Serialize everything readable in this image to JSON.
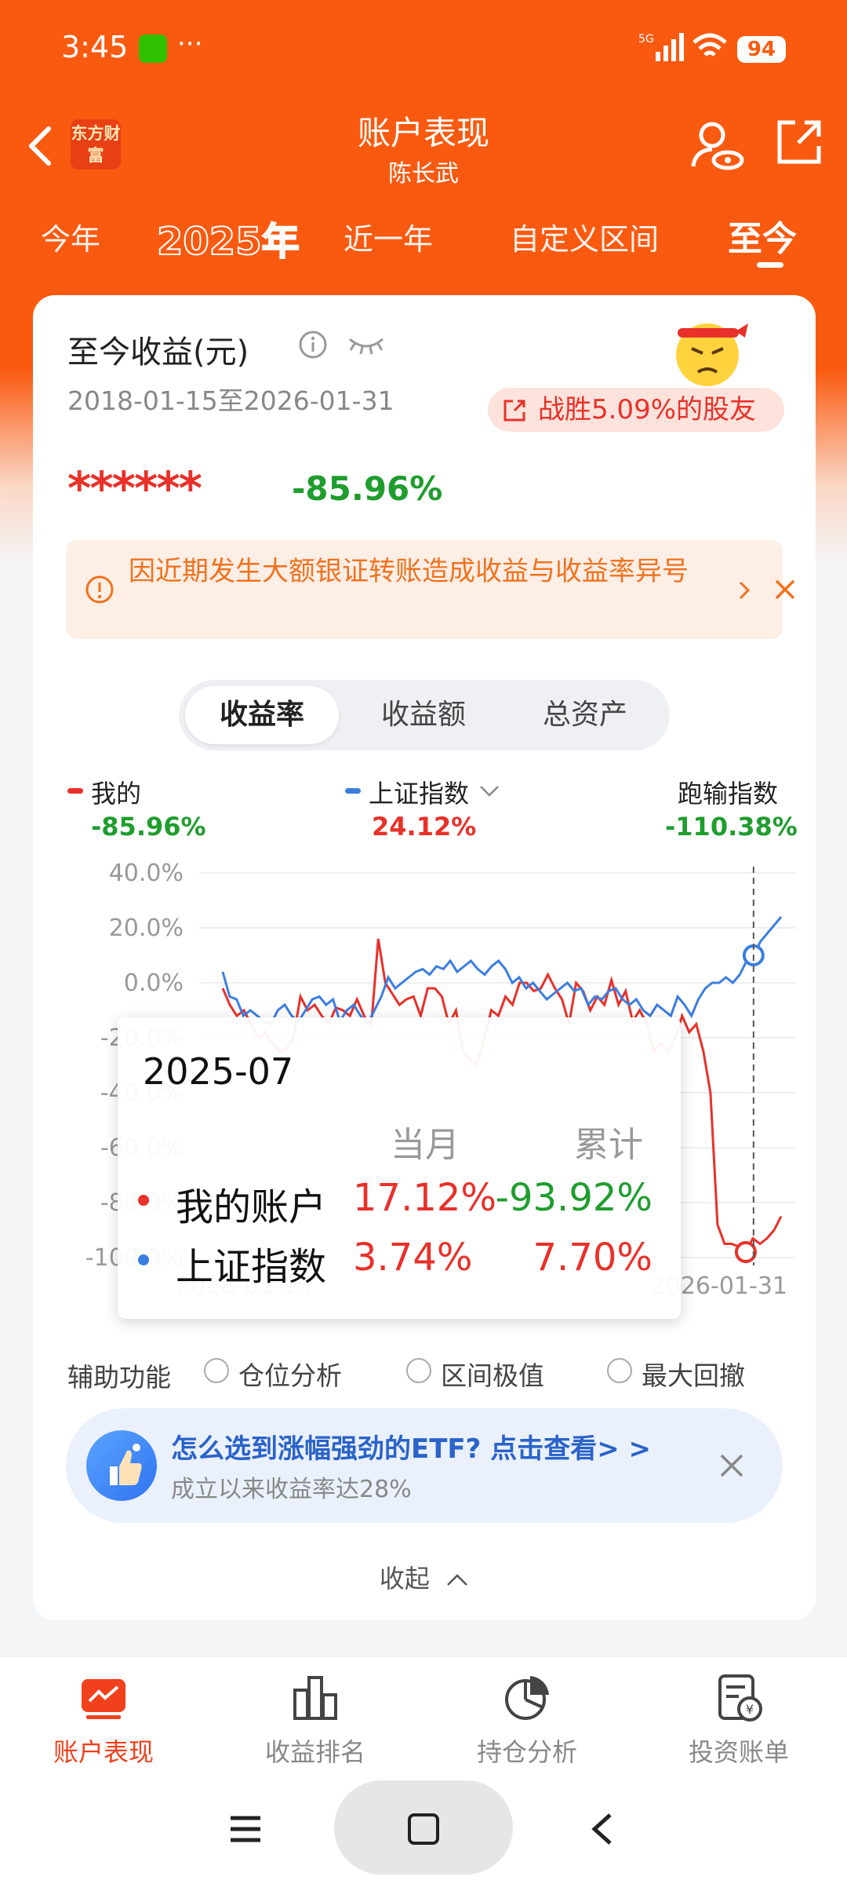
{
  "status_bar": {
    "time": "3:45",
    "more": "···",
    "network": "5G",
    "battery": "94"
  },
  "header": {
    "title": "账户表现",
    "subtitle": "陈长武",
    "logo_text": "东方财富"
  },
  "period_tabs": [
    {
      "label": "今年"
    },
    {
      "label": "2025年"
    },
    {
      "label": "近一年"
    },
    {
      "label": "自定义区间"
    },
    {
      "label": "至今",
      "active": true
    }
  ],
  "summary": {
    "title": "至今收益(元)",
    "date_range": "2018-01-15至2026-01-31",
    "beat_text": "战胜5.09%的股友",
    "masked_amount": "******",
    "total_return": "-85.96%"
  },
  "notice": {
    "text": "因近期发生大额银证转账造成收益与收益率异号"
  },
  "segments": [
    {
      "label": "收益率",
      "active": true
    },
    {
      "label": "收益额"
    },
    {
      "label": "总资产"
    }
  ],
  "legend": {
    "mine": {
      "name": "我的",
      "value": "-85.96%",
      "color": "#e8312a"
    },
    "index": {
      "name": "上证指数",
      "value": "24.12%",
      "color": "#3b7ee0"
    },
    "lag": {
      "name": "跑输指数",
      "value": "-110.38%"
    }
  },
  "chart_data": {
    "type": "line",
    "x_start": "2018-01-15",
    "x_end": "2026-01-31",
    "y_ticks": [
      "40.0%",
      "20.0%",
      "0.0%",
      "-20.0%",
      "-40.0%",
      "-60.0%",
      "-80.0%",
      "-100.0%"
    ],
    "ylim": [
      -100,
      40
    ],
    "series": [
      {
        "name": "我的",
        "color": "#e8312a",
        "values": [
          -2,
          -8,
          -12,
          -10,
          -15,
          -20,
          -18,
          -22,
          -25,
          -24,
          -20,
          -5,
          -10,
          -8,
          -12,
          -15,
          -9,
          -10,
          -12,
          -6,
          -12,
          -16,
          16,
          0,
          -4,
          -8,
          -6,
          -5,
          -12,
          -2,
          -2,
          -5,
          -15,
          -10,
          -25,
          -28,
          -30,
          -20,
          -10,
          -12,
          -5,
          -8,
          0,
          0,
          -3,
          -2,
          3,
          -2,
          -6,
          -15,
          0,
          -3,
          -10,
          -5,
          -8,
          1,
          -8,
          -3,
          -14,
          -10,
          -15,
          -25,
          -22,
          -25,
          -20,
          -12,
          -18,
          -15,
          -25,
          -40,
          -88,
          -95,
          -95,
          -96,
          -98,
          -93,
          -95,
          -93,
          -90,
          -85
        ]
      },
      {
        "name": "上证指数",
        "color": "#3b7ee0",
        "values": [
          4,
          -5,
          -6,
          -12,
          -10,
          -12,
          -14,
          -15,
          -10,
          -8,
          -12,
          -14,
          -10,
          -6,
          -5,
          -8,
          -6,
          -14,
          -10,
          -8,
          -12,
          -15,
          -10,
          -5,
          2,
          -2,
          0,
          2,
          4,
          5,
          3,
          6,
          5,
          8,
          4,
          6,
          8,
          5,
          3,
          6,
          8,
          5,
          0,
          2,
          -2,
          0,
          -3,
          -6,
          -4,
          -2,
          0,
          -3,
          -2,
          -8,
          -5,
          -6,
          -3,
          -2,
          -6,
          -8,
          -6,
          -10,
          -12,
          -8,
          -10,
          -12,
          -5,
          -8,
          -12,
          -6,
          -2,
          0,
          0,
          2,
          0,
          3,
          8,
          10,
          15,
          18,
          21,
          24
        ]
      }
    ],
    "marker_month": "2025-07"
  },
  "tooltip": {
    "month": "2025-07",
    "col_month": "当月",
    "col_total": "累计",
    "rows": [
      {
        "name": "我的账户",
        "month": "17.12%",
        "total": "-93.92%"
      },
      {
        "name": "上证指数",
        "month": "3.74%",
        "total": "7.70%"
      }
    ]
  },
  "aux": {
    "label": "辅助功能",
    "options": [
      {
        "label": "仓位分析"
      },
      {
        "label": "区间极值"
      },
      {
        "label": "最大回撤"
      }
    ]
  },
  "promo": {
    "title": "怎么选到涨幅强劲的ETF? 点击查看> >",
    "subtitle": "成立以来收益率达28%"
  },
  "collapse": {
    "label": "收起"
  },
  "bottom_nav": [
    {
      "label": "账户表现",
      "active": true,
      "icon": "chart-screen-icon"
    },
    {
      "label": "收益排名",
      "icon": "bar-ranking-icon"
    },
    {
      "label": "持仓分析",
      "icon": "pie-icon"
    },
    {
      "label": "投资账单",
      "icon": "bill-icon"
    }
  ],
  "colors": {
    "brand_orange": "#f95a10",
    "red": "#e8312a",
    "green": "#1f9d2e",
    "blue": "#3b7ee0"
  }
}
